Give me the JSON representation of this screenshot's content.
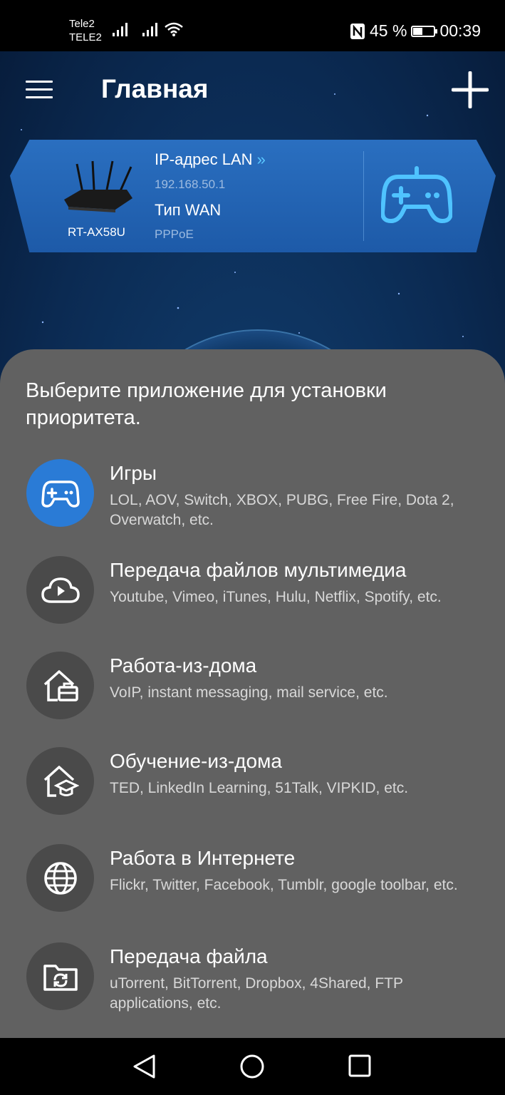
{
  "status": {
    "carrier1": "Tele2",
    "carrier2": "TELE2",
    "battery_text": "45 %",
    "battery_level": 0.45,
    "time": "00:39"
  },
  "header": {
    "title": "Главная",
    "menu_icon": "hamburger-menu-icon",
    "add_icon": "plus-icon"
  },
  "router": {
    "model": "RT-AX58U",
    "ip_label": "IP-адрес LAN",
    "ip_value": "192.168.50.1",
    "wan_label": "Тип WAN",
    "wan_value": "PPPoE",
    "mode_icon": "gamepad-icon"
  },
  "sheet": {
    "title": "Выберите приложение для установки приоритета.",
    "options": [
      {
        "title": "Игры",
        "desc": "LOL, AOV, Switch, XBOX, PUBG, Free Fire, Dota 2, Overwatch, etc.",
        "icon": "gamepad-icon",
        "selected": true
      },
      {
        "title": "Передача файлов мультимедиа",
        "desc": "Youtube, Vimeo, iTunes, Hulu, Netflix, Spotify, etc.",
        "icon": "cloud-play-icon",
        "selected": false
      },
      {
        "title": "Работа-из-дома",
        "desc": "VoIP, instant messaging, mail service, etc.",
        "icon": "home-briefcase-icon",
        "selected": false
      },
      {
        "title": "Обучение-из-дома",
        "desc": "TED, LinkedIn Learning, 51Talk, VIPKID, etc.",
        "icon": "home-graduation-icon",
        "selected": false
      },
      {
        "title": "Работа в Интернете",
        "desc": "Flickr, Twitter, Facebook, Tumblr, google toolbar, etc.",
        "icon": "globe-icon",
        "selected": false
      },
      {
        "title": "Передача файла",
        "desc": "uTorrent, BitTorrent, Dropbox, 4Shared, FTP applications, etc.",
        "icon": "folder-sync-icon",
        "selected": false
      }
    ]
  },
  "colors": {
    "accent": "#2a7bd6",
    "sheet_bg": "#616161",
    "icon_circle": "#4a4a4a"
  }
}
